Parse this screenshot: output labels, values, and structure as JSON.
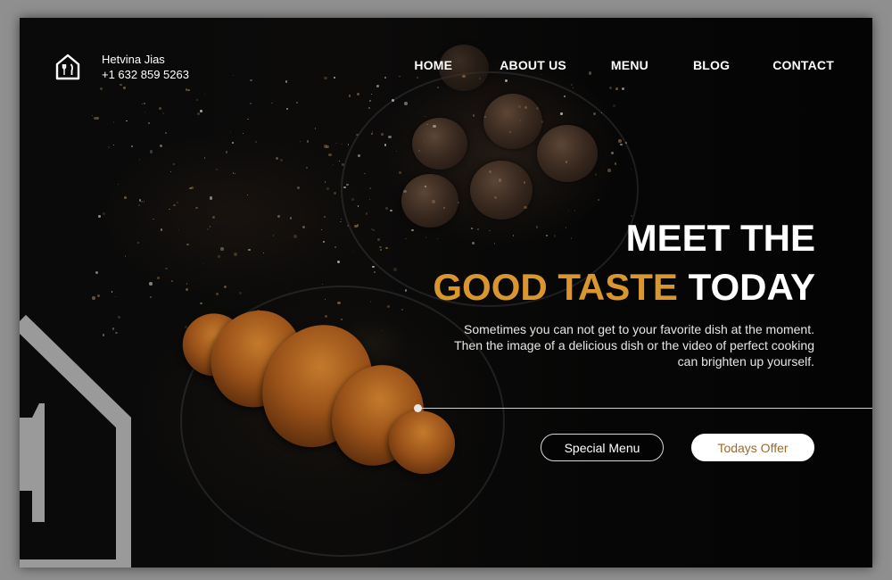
{
  "brand": {
    "name": "Hetvina Jias",
    "phone": "+1 632 859 5263",
    "logo_icon": "house-fork-knife-icon"
  },
  "nav": {
    "items": [
      {
        "label": "HOME"
      },
      {
        "label": "ABOUT US"
      },
      {
        "label": "MENU"
      },
      {
        "label": "BLOG"
      },
      {
        "label": "CONTACT"
      }
    ]
  },
  "hero": {
    "line1": "MEET THE",
    "line2_accent": "GOOD TASTE",
    "line2_rest": " TODAY",
    "description_lines": [
      "Sometimes you can not get to your favorite dish at the moment.",
      "Then the image of a delicious dish or the video of perfect cooking",
      "can brighten up yourself."
    ]
  },
  "buttons": {
    "special_label": "Special Menu",
    "offer_label": "Todays Offer"
  },
  "colors": {
    "accent": "#d9962f",
    "background": "#070707",
    "text": "#ffffff"
  }
}
